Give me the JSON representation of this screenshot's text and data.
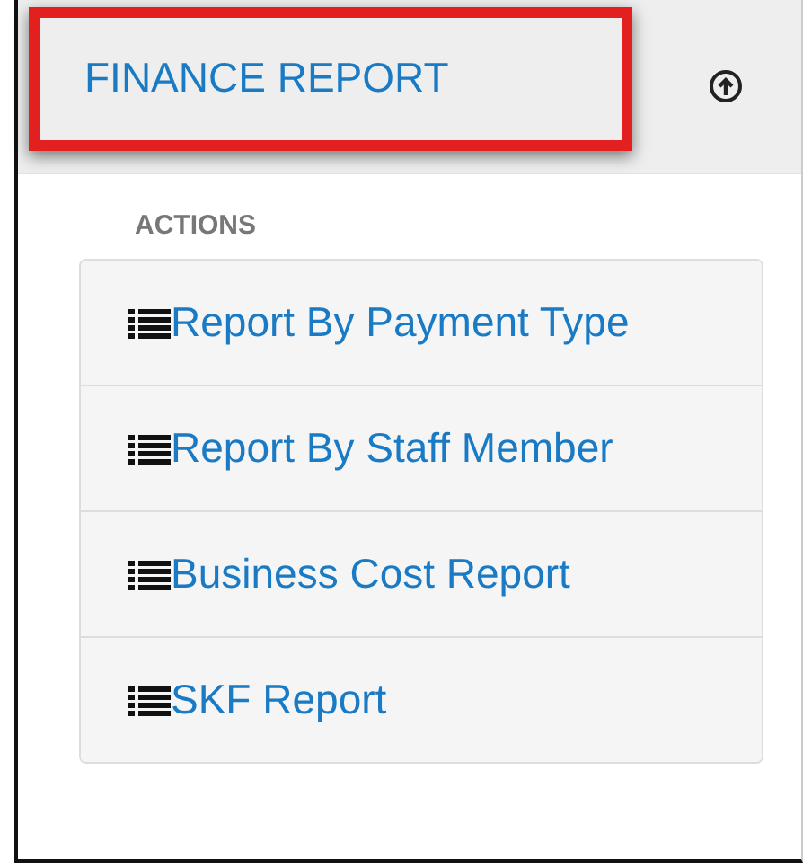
{
  "header": {
    "title": "FINANCE REPORT",
    "highlighted": true
  },
  "section": {
    "heading": "ACTIONS",
    "items": [
      {
        "label": "Report By Payment Type"
      },
      {
        "label": "Report By Staff Member"
      },
      {
        "label": "Business Cost Report"
      },
      {
        "label": "SKF Report"
      }
    ]
  }
}
